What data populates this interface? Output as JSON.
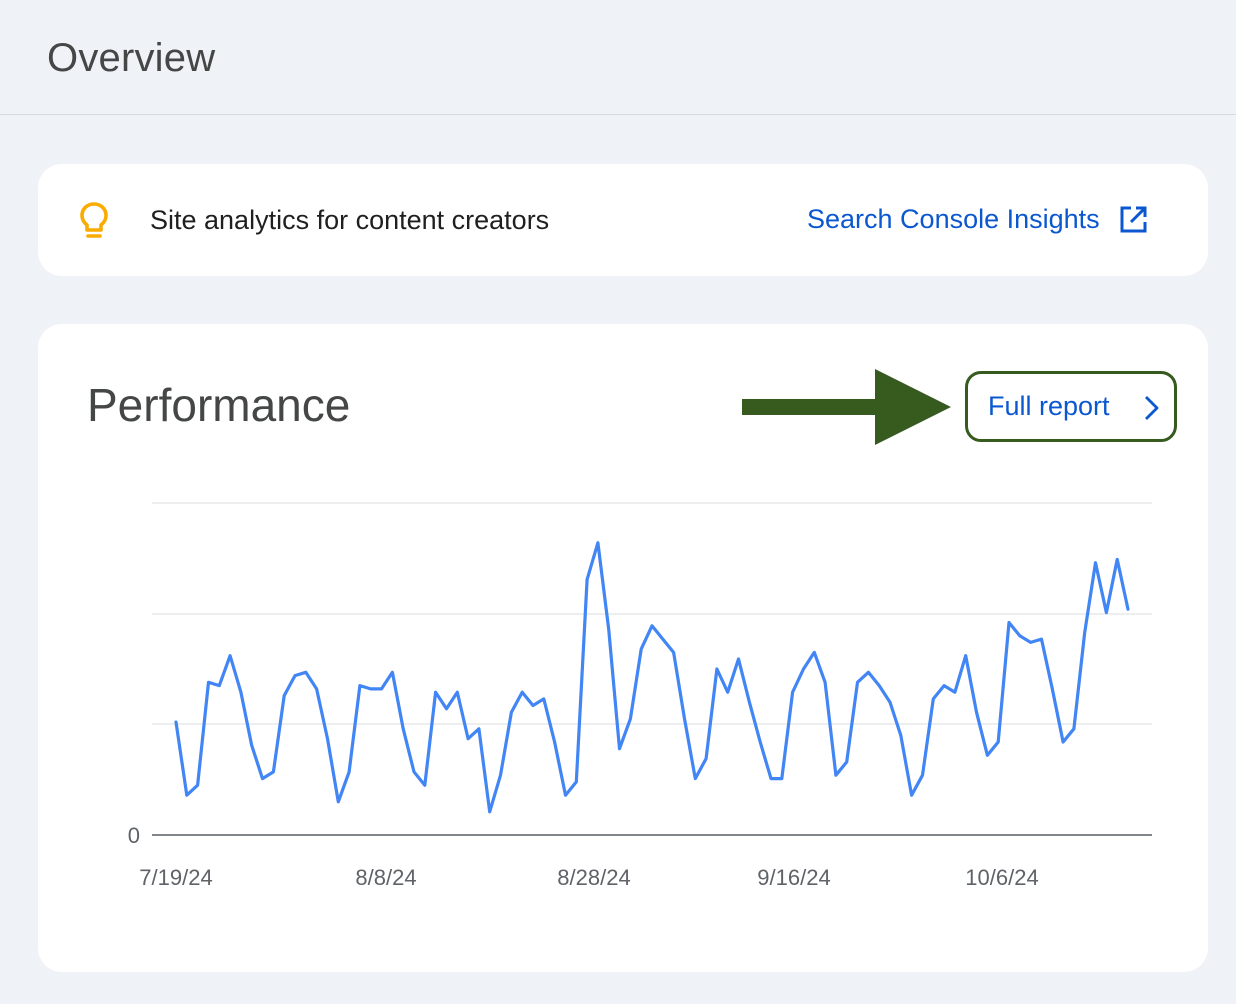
{
  "header": {
    "title": "Overview"
  },
  "insights": {
    "text": "Site analytics for content creators",
    "link_label": "Search Console Insights",
    "icon": "lightbulb-icon",
    "link_icon": "open-in-new-icon"
  },
  "performance": {
    "title": "Performance",
    "full_report_label": "Full report",
    "full_report_icon": "chevron-right-icon"
  },
  "colors": {
    "background": "#eff3f8",
    "card": "#ffffff",
    "link": "#0b57d0",
    "line": "#4285f4",
    "annotation": "#375a1e",
    "bulb": "#f9ab00"
  },
  "chart_data": {
    "type": "line",
    "x_tick_labels": [
      "7/19/24",
      "8/8/24",
      "8/28/24",
      "9/16/24",
      "10/6/24"
    ],
    "y_tick_labels": [
      "0"
    ],
    "grid": true,
    "legend": "none",
    "series": [
      {
        "values": [
          0.34,
          0.12,
          0.15,
          0.46,
          0.45,
          0.54,
          0.43,
          0.27,
          0.17,
          0.19,
          0.42,
          0.48,
          0.49,
          0.44,
          0.29,
          0.1,
          0.19,
          0.45,
          0.44,
          0.44,
          0.49,
          0.32,
          0.19,
          0.15,
          0.43,
          0.38,
          0.43,
          0.29,
          0.32,
          0.07,
          0.18,
          0.37,
          0.43,
          0.39,
          0.41,
          0.28,
          0.12,
          0.16,
          0.77,
          0.88,
          0.62,
          0.26,
          0.35,
          0.56,
          0.63,
          0.59,
          0.55,
          0.35,
          0.17,
          0.23,
          0.5,
          0.43,
          0.53,
          0.4,
          0.28,
          0.17,
          0.17,
          0.43,
          0.5,
          0.55,
          0.46,
          0.18,
          0.22,
          0.46,
          0.49,
          0.45,
          0.4,
          0.3,
          0.12,
          0.18,
          0.41,
          0.45,
          0.43,
          0.54,
          0.37,
          0.24,
          0.28,
          0.64,
          0.6,
          0.58,
          0.59,
          0.44,
          0.28,
          0.32,
          0.61,
          0.82,
          0.67,
          0.83,
          0.68
        ]
      }
    ]
  }
}
